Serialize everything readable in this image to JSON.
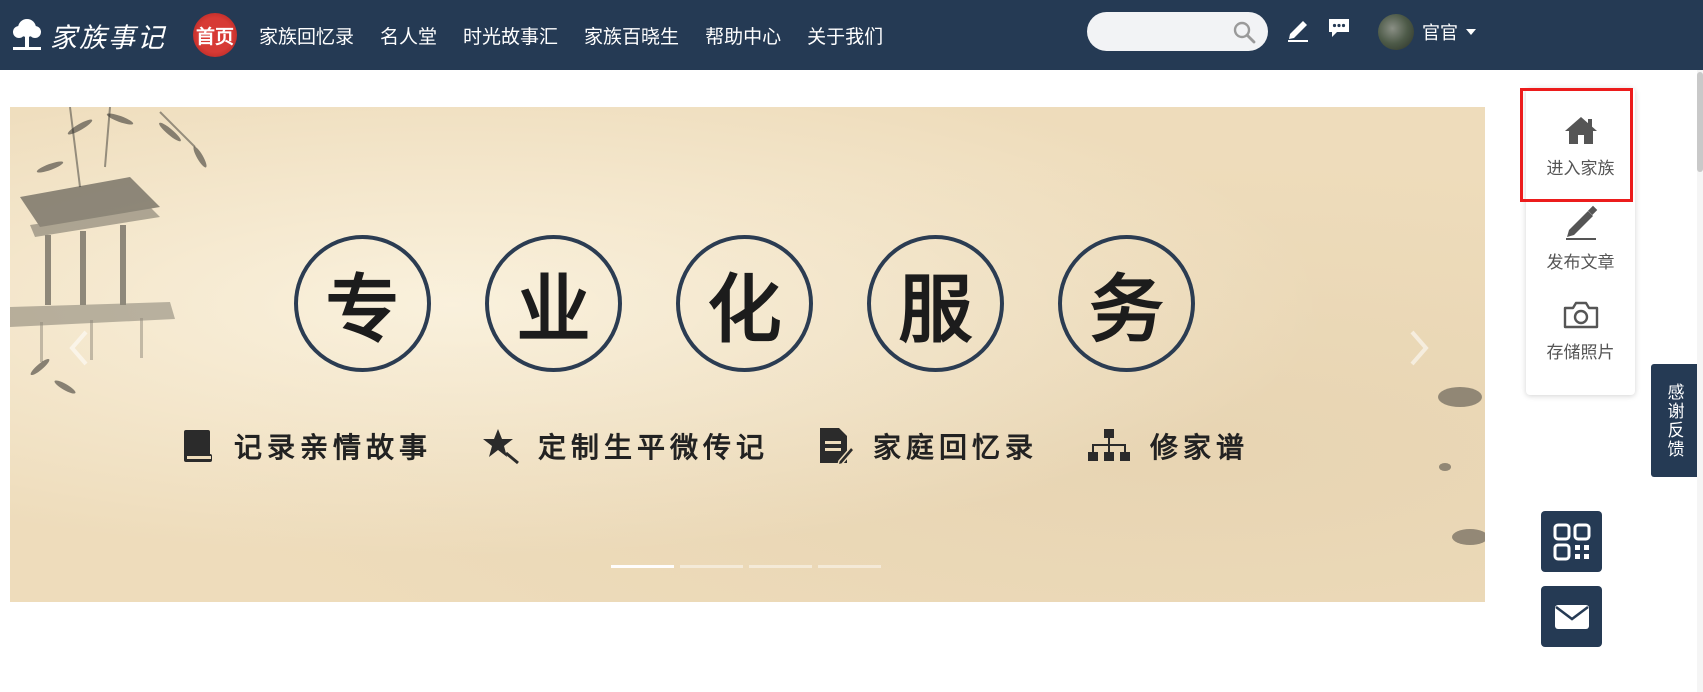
{
  "header": {
    "logo_text": "家族事记",
    "nav": [
      "首页",
      "家族回忆录",
      "名人堂",
      "时光故事汇",
      "家族百晓生",
      "帮助中心",
      "关于我们"
    ],
    "search_placeholder": "",
    "user_name": "官官"
  },
  "banner": {
    "circle_chars": [
      "专",
      "业",
      "化",
      "服",
      "务"
    ],
    "features": [
      "记录亲情故事",
      "定制生平微传记",
      "家庭回忆录",
      "修家谱"
    ],
    "slides_count": 4,
    "active_slide": 1
  },
  "side_panel": {
    "items": [
      "进入家族",
      "发布文章",
      "存储照片"
    ]
  },
  "feedback": "感谢反馈",
  "colors": {
    "header_bg": "#253a54",
    "home_accent": "#d73a35",
    "highlight": "#ec1c1c",
    "banner_bg": "#eedcbb"
  },
  "icons": [
    "logo-tree-icon",
    "search-icon",
    "pencil-icon",
    "chat-icon",
    "home-icon",
    "edit-icon",
    "camera-icon",
    "qr-code-icon",
    "mail-icon"
  ]
}
